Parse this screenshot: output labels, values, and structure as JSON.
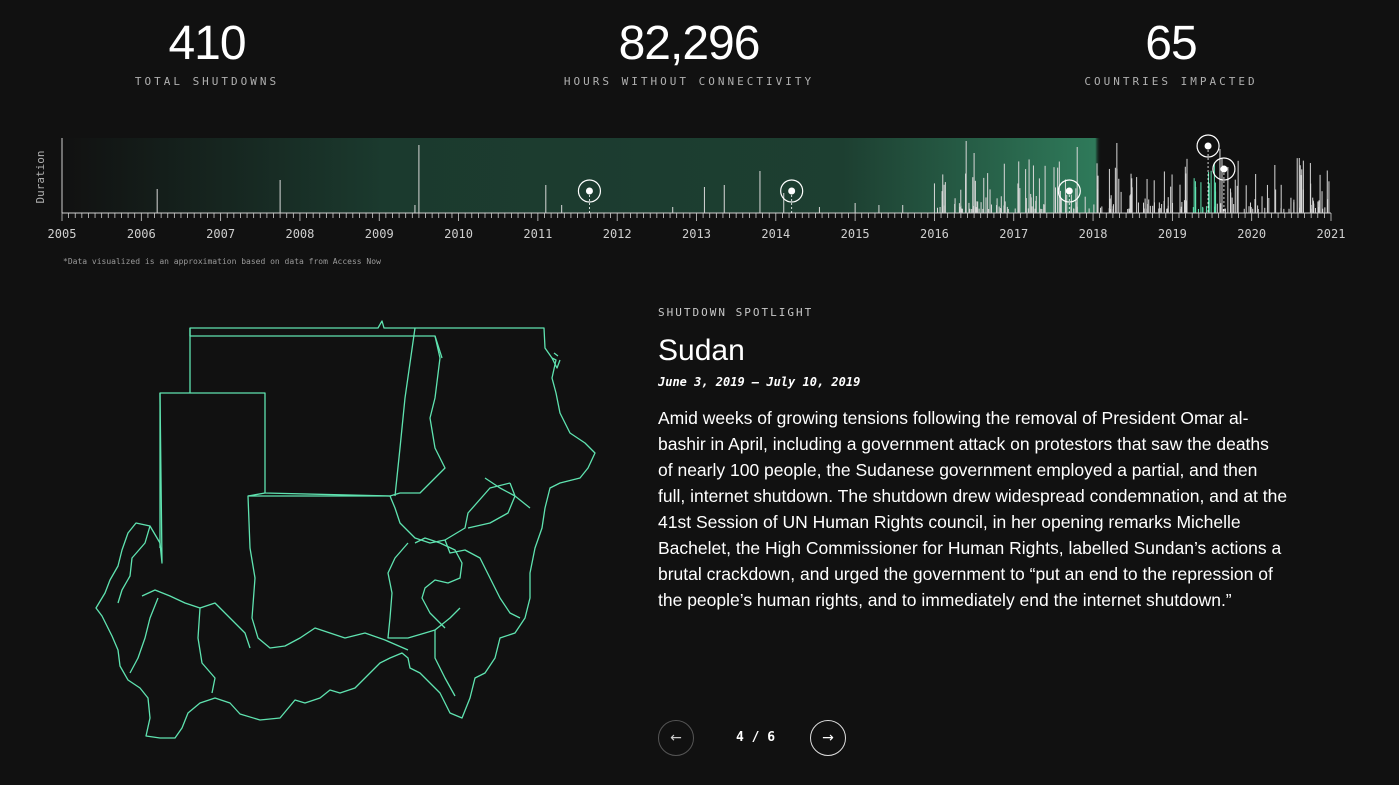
{
  "stats": [
    {
      "value": "410",
      "label": "TOTAL SHUTDOWNS"
    },
    {
      "value": "82,296",
      "label": "HOURS WITHOUT CONNECTIVITY"
    },
    {
      "value": "65",
      "label": "COUNTRIES IMPACTED"
    }
  ],
  "timeline": {
    "y_label": "Duration",
    "years": [
      "2005",
      "2006",
      "2007",
      "2008",
      "2009",
      "2010",
      "2011",
      "2012",
      "2013",
      "2014",
      "2015",
      "2016",
      "2017",
      "2018",
      "2019",
      "2020",
      "2021"
    ],
    "footnote": "*Data visualized is an approximation based on data from Access Now",
    "accent": "#5fe3b0",
    "highlight_markers": [
      2011.65,
      2014.2,
      2017.7,
      2019.45,
      2019.65
    ]
  },
  "spotlight": {
    "eyebrow": "SHUTDOWN SPOTLIGHT",
    "country": "Sudan",
    "dates": "June 3, 2019 – July 10, 2019",
    "body": "Amid weeks of growing tensions following the removal of President Omar al-bashir in April, including a government attack on protestors that saw the deaths of nearly 100 people, the Sudanese government employed a partial, and then full, internet shutdown. The shutdown drew widespread condemnation, and at the 41st Session of UN Human Rights council, in her opening remarks Michelle Bachelet, the High Commissioner for Human Rights, labelled Sundan’s actions a brutal crackdown, and urged the government to “put an end to the repression of the people’s human rights, and to immediately end the internet shutdown.”",
    "map_color": "#5fe3b0"
  },
  "pager": {
    "prev_icon": "←",
    "next_icon": "→",
    "count": "4 / 6"
  }
}
